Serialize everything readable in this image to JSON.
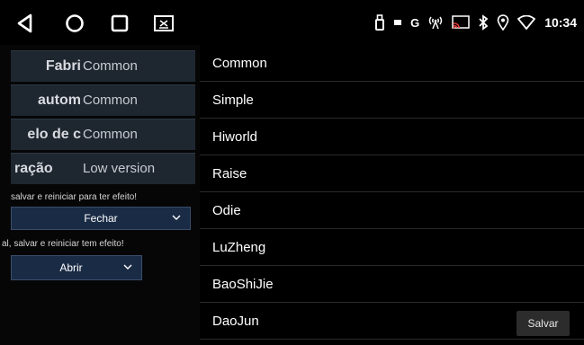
{
  "statusbar": {
    "time": "10:34",
    "indicators": [
      "usb-icon",
      "battery-icon",
      "google-icon",
      "wireless-signal-icon",
      "cast-icon",
      "bluetooth-icon",
      "location-icon",
      "wifi-icon"
    ],
    "g_letter": "G"
  },
  "navbar": {
    "buttons": [
      "back-icon",
      "home-icon",
      "recent-apps-icon",
      "screenshot-icon"
    ]
  },
  "settings": {
    "rows": [
      {
        "key": "Fabri",
        "value": "Common"
      },
      {
        "key": "autom",
        "value": "Common"
      },
      {
        "key": "elo de c",
        "value": "Common"
      },
      {
        "key": "ração",
        "value": "Low version"
      }
    ],
    "hint1": "salvar e reiniciar para ter efeito!",
    "dropdown1": "Fechar",
    "hint2": "al, salvar e reiniciar tem efeito!",
    "dropdown2": "Abrir"
  },
  "list": {
    "items": [
      "Common",
      "Simple",
      "Hiworld",
      "Raise",
      "Odie",
      "LuZheng",
      "BaoShiJie",
      "DaoJun"
    ],
    "save_label": "Salvar"
  },
  "colors": {
    "row_bg": "#1e2630",
    "dropdown_bg": "#1a2b45",
    "button_bg": "#2c2c2c"
  }
}
